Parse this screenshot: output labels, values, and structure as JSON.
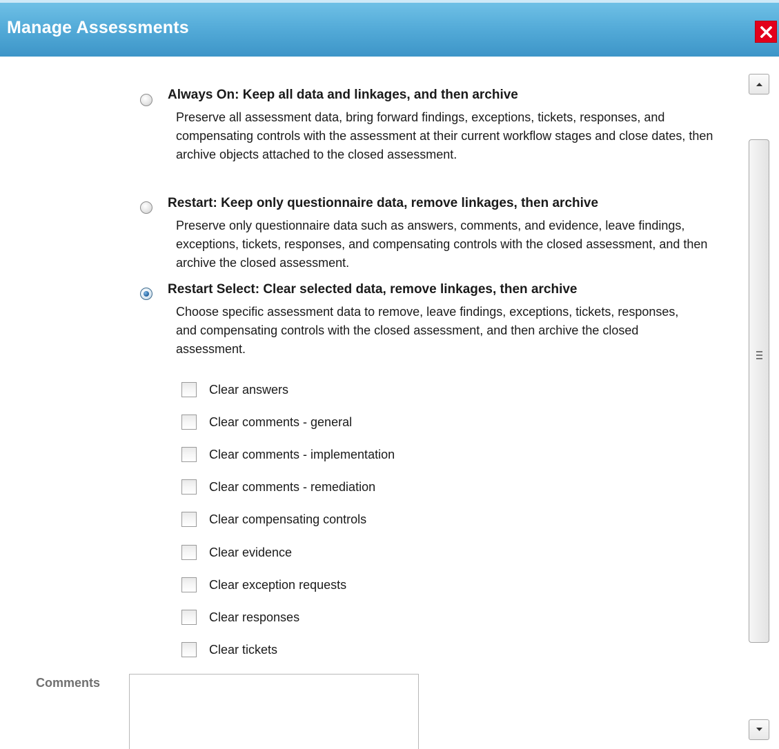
{
  "dialog": {
    "title": "Manage Assessments",
    "close_icon": "close-icon",
    "accent_color": "#4aa3d4",
    "close_color": "#e3001b"
  },
  "options": [
    {
      "title": "Always On: Keep all data and linkages, and then archive",
      "description": "Preserve all assessment data, bring forward findings, exceptions, tickets, responses, and compensating controls with the assessment at their current workflow stages and close dates, then archive objects attached to the closed assessment.",
      "selected": false
    },
    {
      "title": "Restart: Keep only questionnaire data, remove linkages, then archive",
      "description": "Preserve only questionnaire data such as answers, comments, and evidence, leave findings, exceptions, tickets, responses, and compensating controls with the closed assessment, and then archive the closed assessment.",
      "selected": false
    },
    {
      "title": "Restart Select: Clear selected data, remove linkages, then archive",
      "description": "Choose specific assessment data to remove, leave findings, exceptions, tickets, responses, and compensating controls with the closed assessment, and then archive the closed assessment.",
      "selected": true
    }
  ],
  "clear_options": [
    {
      "label": "Clear answers",
      "checked": false
    },
    {
      "label": "Clear comments - general",
      "checked": false
    },
    {
      "label": "Clear comments - implementation",
      "checked": false
    },
    {
      "label": "Clear comments - remediation",
      "checked": false
    },
    {
      "label": "Clear compensating controls",
      "checked": false
    },
    {
      "label": "Clear evidence",
      "checked": false
    },
    {
      "label": "Clear exception requests",
      "checked": false
    },
    {
      "label": "Clear responses",
      "checked": false
    },
    {
      "label": "Clear tickets",
      "checked": false
    }
  ],
  "comments": {
    "label": "Comments",
    "value": ""
  },
  "scrollbar": {
    "up_icon": "arrow-up-icon",
    "down_icon": "arrow-down-icon",
    "grip_icon": "grip-icon"
  }
}
